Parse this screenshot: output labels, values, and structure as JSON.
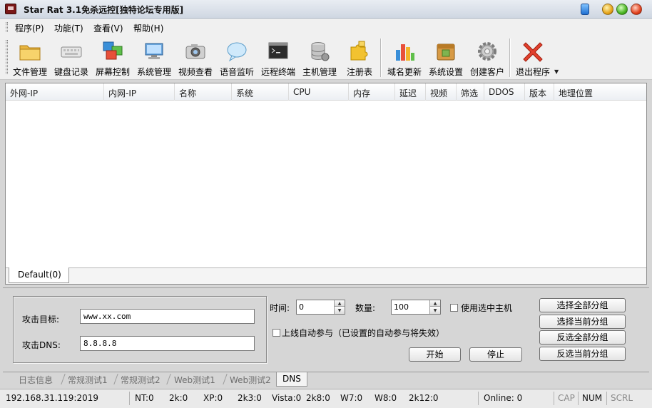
{
  "window": {
    "title": "Star Rat 3.1免杀远控[独特论坛专用版]"
  },
  "menu": [
    "程序(P)",
    "功能(T)",
    "查看(V)",
    "帮助(H)"
  ],
  "toolbar": [
    {
      "label": "文件管理",
      "icon": "folder-icon"
    },
    {
      "label": "键盘记录",
      "icon": "keyboard-icon"
    },
    {
      "label": "屏幕控制",
      "icon": "screen-control-icon"
    },
    {
      "label": "系统管理",
      "icon": "system-manage-icon"
    },
    {
      "label": "视频查看",
      "icon": "camera-icon"
    },
    {
      "label": "语音监听",
      "icon": "speech-bubble-icon"
    },
    {
      "label": "远程终端",
      "icon": "terminal-icon"
    },
    {
      "label": "主机管理",
      "icon": "database-icon"
    },
    {
      "label": "注册表",
      "icon": "puzzle-icon"
    },
    {
      "label": "域名更新",
      "icon": "bar-chart-icon"
    },
    {
      "label": "系统设置",
      "icon": "box-icon"
    },
    {
      "label": "创建客户",
      "icon": "gear-icon"
    },
    {
      "label": "退出程序",
      "icon": "close-x-icon"
    }
  ],
  "list": {
    "columns": [
      "外网-IP",
      "内网-IP",
      "名称",
      "系统",
      "CPU",
      "内存",
      "延迟",
      "视频",
      "筛选",
      "DDOS",
      "版本",
      "地理位置"
    ],
    "tab": "Default(0)"
  },
  "attack": {
    "target_label": "攻击目标:",
    "target_value": "www.xx.com",
    "dns_label": "攻击DNS:",
    "dns_value": "8.8.8.8",
    "time_label": "时间:",
    "time_value": "0",
    "count_label": "数量:",
    "count_value": "100",
    "use_selected_label": "使用选中主机",
    "auto_join_label": "上线自动参与（已设置的自动参与将失效）",
    "start_label": "开始",
    "stop_label": "停止",
    "select_all_label": "选择全部分组",
    "select_current_label": "选择当前分组",
    "invert_all_label": "反选全部分组",
    "invert_current_label": "反选当前分组"
  },
  "bottom_tabs": [
    "日志信息",
    "常规测试1",
    "常规测试2",
    "Web测试1",
    "Web测试2",
    "DNS"
  ],
  "status": {
    "address": "192.168.31.119:2019",
    "nt": "NT:0",
    "k2": "2k:0",
    "xp": "XP:0",
    "k23": "2k3:0",
    "vista": "Vista:0",
    "k28": "2k8:0",
    "w7": "W7:0",
    "w8": "W8:0",
    "k12": "2k12:0",
    "online": "Online: 0",
    "cap": "CAP",
    "num": "NUM",
    "scrl": "SCRL"
  }
}
